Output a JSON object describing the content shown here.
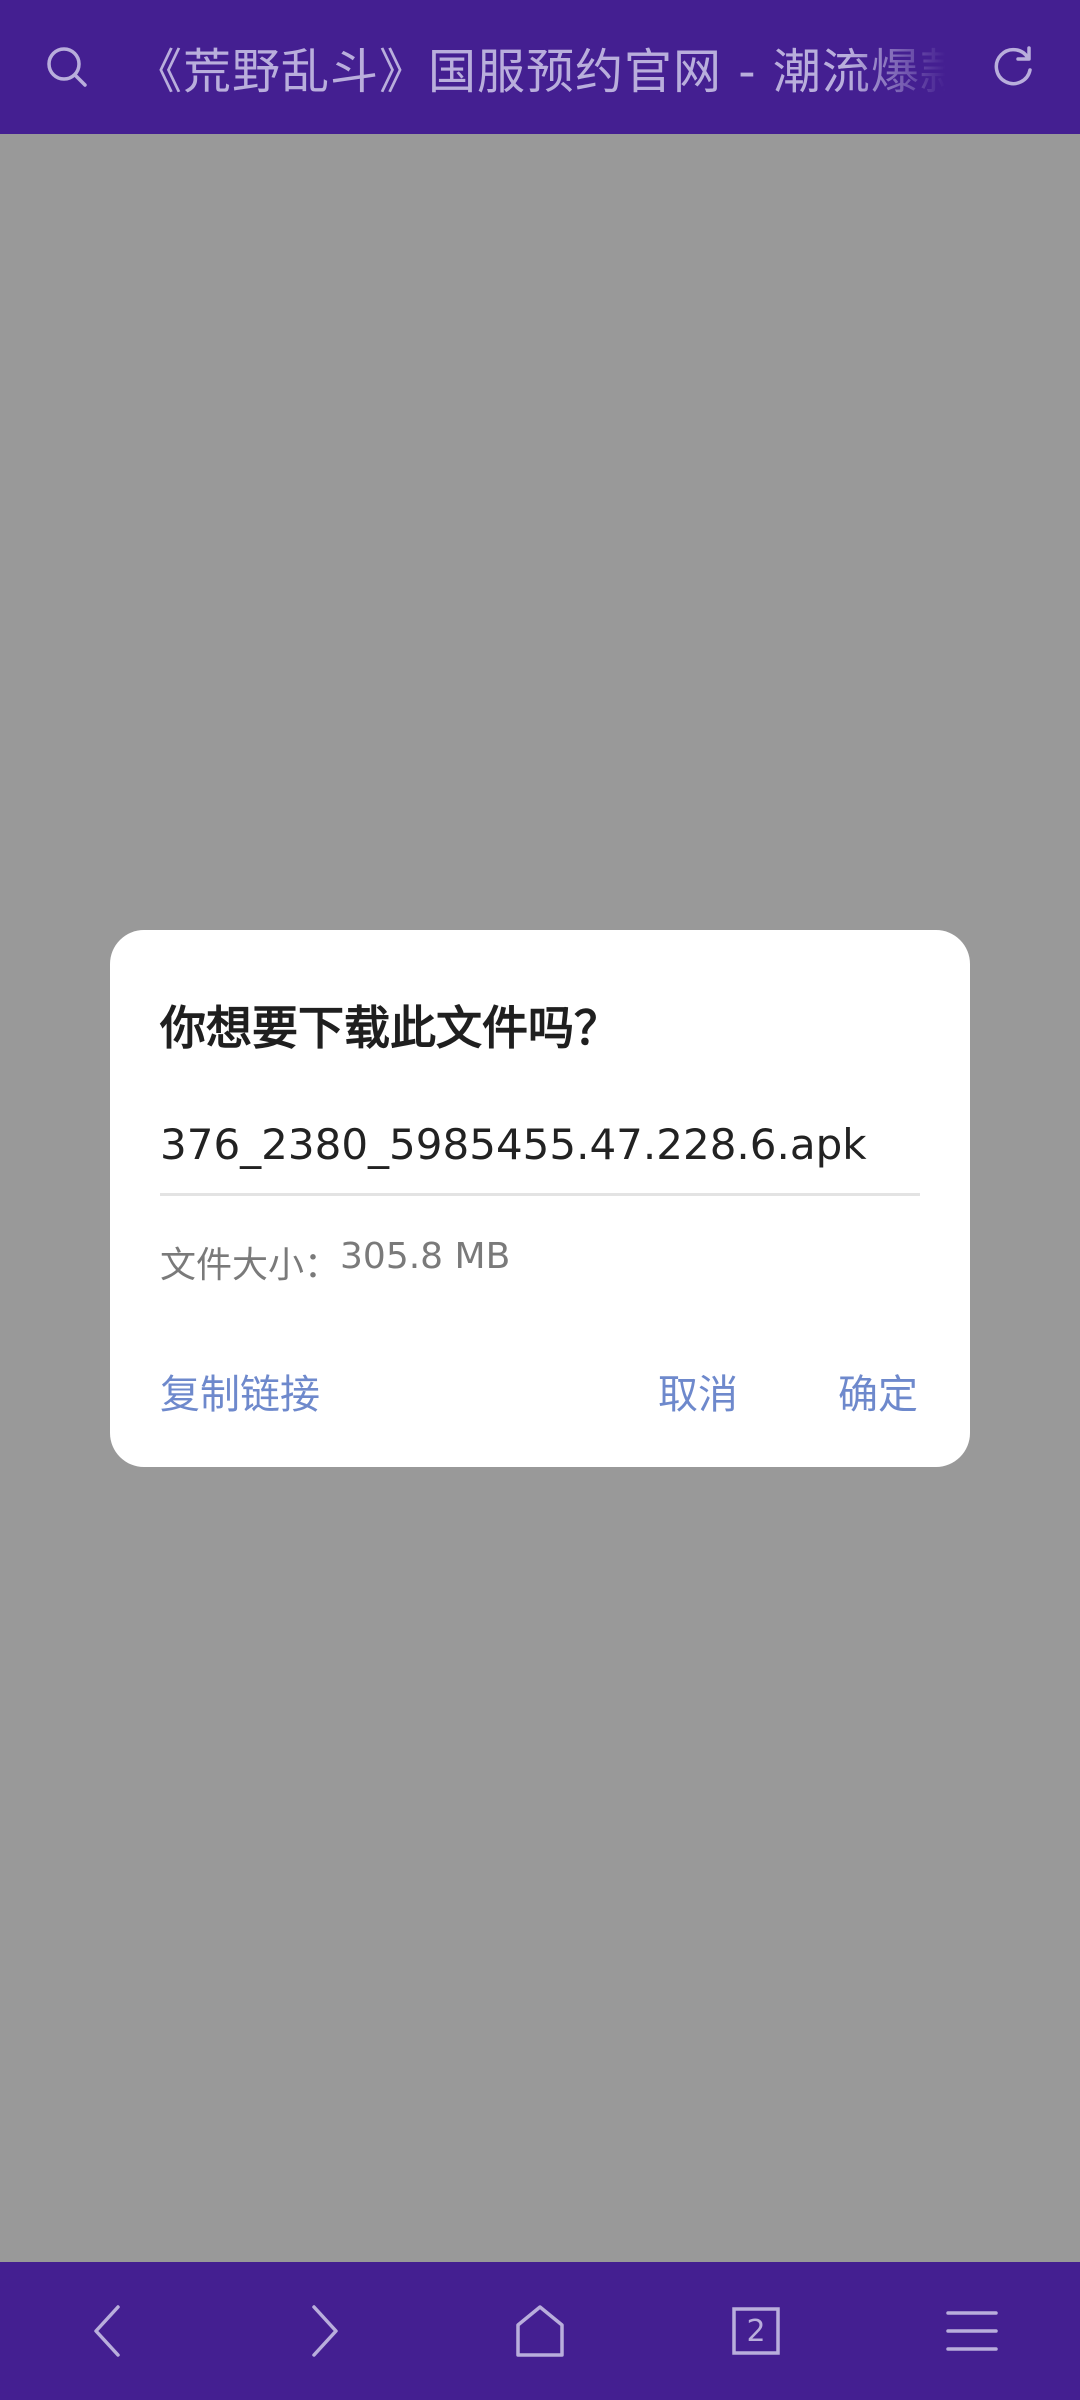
{
  "colors": {
    "bar_background": "#441f91",
    "bar_foreground": "#b9aedc",
    "overlay_background": "#999999",
    "dialog_background": "#ffffff",
    "dialog_accent": "#6e89cc"
  },
  "header": {
    "page_title": "《荒野乱斗》国服预约官网 - 潮流爆款",
    "left_icon": "search-icon",
    "right_icon": "refresh-icon"
  },
  "dialog": {
    "title": "你想要下载此文件吗？",
    "filename": "376_2380_5985455.47.228.6.apk",
    "size_label": "文件大小：",
    "size_value": "305.8 MB",
    "copy_link_label": "复制链接",
    "cancel_label": "取消",
    "confirm_label": "确定"
  },
  "bottom_nav": {
    "items": [
      {
        "icon": "back-icon"
      },
      {
        "icon": "forward-icon"
      },
      {
        "icon": "home-icon"
      },
      {
        "icon": "tabs-icon",
        "count": "2"
      },
      {
        "icon": "menu-icon"
      }
    ]
  }
}
